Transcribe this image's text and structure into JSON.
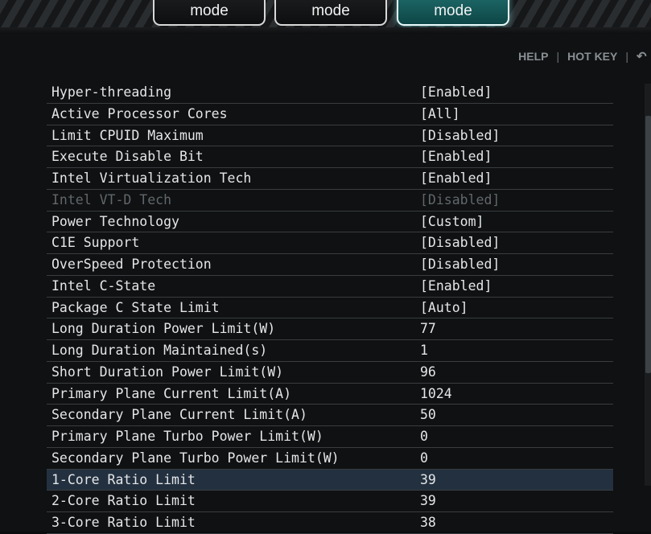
{
  "modes": [
    {
      "label": "mode",
      "active": false
    },
    {
      "label": "mode",
      "active": false
    },
    {
      "label": "mode",
      "active": true
    }
  ],
  "toolbar": {
    "help": "HELP",
    "separator": "|",
    "hotkey": "HOT KEY",
    "back_icon": "undo-arrow-icon"
  },
  "settings": [
    {
      "label": "Hyper-threading",
      "value": "[Enabled]"
    },
    {
      "label": "Active Processor Cores",
      "value": "[All]"
    },
    {
      "label": "Limit CPUID Maximum",
      "value": "[Disabled]"
    },
    {
      "label": "Execute Disable Bit",
      "value": "[Enabled]"
    },
    {
      "label": "Intel Virtualization Tech",
      "value": "[Enabled]"
    },
    {
      "label": "Intel VT-D Tech",
      "value": "[Disabled]",
      "disabled": true
    },
    {
      "label": "Power Technology",
      "value": "[Custom]"
    },
    {
      "label": "C1E Support",
      "value": "[Disabled]"
    },
    {
      "label": "OverSpeed Protection",
      "value": "[Disabled]"
    },
    {
      "label": "Intel C-State",
      "value": "[Enabled]"
    },
    {
      "label": "Package C State Limit",
      "value": "[Auto]"
    },
    {
      "label": "Long Duration Power Limit(W)",
      "value": "77"
    },
    {
      "label": "Long Duration Maintained(s)",
      "value": "1"
    },
    {
      "label": "Short Duration Power Limit(W)",
      "value": "96"
    },
    {
      "label": "Primary Plane Current Limit(A)",
      "value": "1024"
    },
    {
      "label": "Secondary Plane Current Limit(A)",
      "value": "50"
    },
    {
      "label": "Primary Plane Turbo Power Limit(W)",
      "value": "0"
    },
    {
      "label": "Secondary Plane Turbo Power Limit(W)",
      "value": "0"
    },
    {
      "label": "1-Core Ratio Limit",
      "value": "39",
      "selected": true
    },
    {
      "label": "2-Core Ratio Limit",
      "value": "39"
    },
    {
      "label": "3-Core Ratio Limit",
      "value": "38"
    }
  ]
}
